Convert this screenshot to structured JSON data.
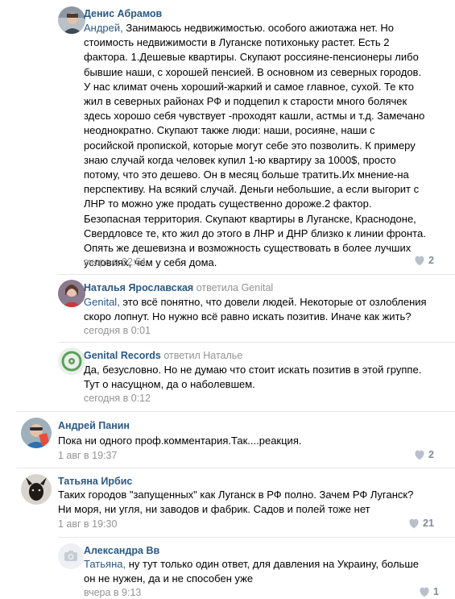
{
  "comments": [
    {
      "author": "Денис Абрамов",
      "address": "Андрей,",
      "text": " Занимаюсь недвижимостью. особого ажиотажа нет. Но\nстоимость недвижимости в Луганске потихоньку растет. Есть 2\nфактора. 1.Дешевые квартиры. Скупают россияне-пенсионеры либо\nбывшие наши, с хорошей пенсией. В основном из северных городов.\nУ нас климат очень хороший-жаркий и самое главное, сухой. Те кто\nжил в северных районах РФ и подцепил к старости много болячек\nздесь хорошо себя чувствует -проходят кашли, астмы и т.д. Замечано\nнеоднократно. Скупают также люди: наши, росияне, наши с\nросийской пропиской, которые могут себе это позволить. К примеру\nзнаю случай когда человек купил 1-ю квартиру за 1000$, просто\nпотому, что это дешево. Он в месяц больше тратить.Их мнение-на\nперспективу. На всякий случай. Деньги небольшие, а если выгорит с\nЛНР то можно уже продать существенно дороже.2 фактор.\nБезопасная территория. Скупают квартиры в Луганске, Краснодоне,\nСвердловсе те, кто жил до этого в ЛНР и ДНР близко к линии фронта.\nОпять же дешевизна и возможность существовать в более лучших\nусловиях, чем у себя дома.",
      "time": "вчера в 22:51",
      "likes": "2"
    },
    {
      "author": "Наталья Ярославская",
      "reply_to": "ответила Genital",
      "address": "Genital,",
      "text": " это всё понятно, что довели людей. Некоторые от озлобления\nскоро лопнут. Но нужно всё равно искать позитив. Иначе как жить?",
      "time": "сегодня в 0:01",
      "likes": ""
    },
    {
      "author": "Genital Records",
      "reply_to": "ответил Наталье",
      "address": "",
      "text": "Да, безусловно. Но не думаю что стоит искать позитив в этой группе.\nТут о насущном, да о наболевшем.",
      "time": "сегодня в 0:12",
      "likes": ""
    },
    {
      "author": "Андрей Панин",
      "address": "",
      "text": "Пока ни одного проф.комментария.Так....реакция.",
      "time": "1 авг в 19:37",
      "likes": "2"
    },
    {
      "author": "Татьяна Ирбис",
      "address": "",
      "text": "Таких городов \"запущенных\" как Луганск в РФ полно. Зачем РФ Луганск?\nНи моря, ни угля, ни заводов и фабрик. Садов и полей тоже нет",
      "time": "1 авг в 19:30",
      "likes": "21"
    },
    {
      "author": "Александра Вв",
      "address": "Татьяна,",
      "text": " ну тут только один ответ, для давления на Украину, больше\nон не нужен, да и не способен уже",
      "time": "вчера в 9:13",
      "likes": "1"
    }
  ],
  "colors": {
    "link": "#2a5885",
    "meta": "#939393",
    "like": "#828a99",
    "divider": "#e7e8ec"
  },
  "icons": {
    "like": "heart-icon",
    "camera": "camera-icon"
  }
}
